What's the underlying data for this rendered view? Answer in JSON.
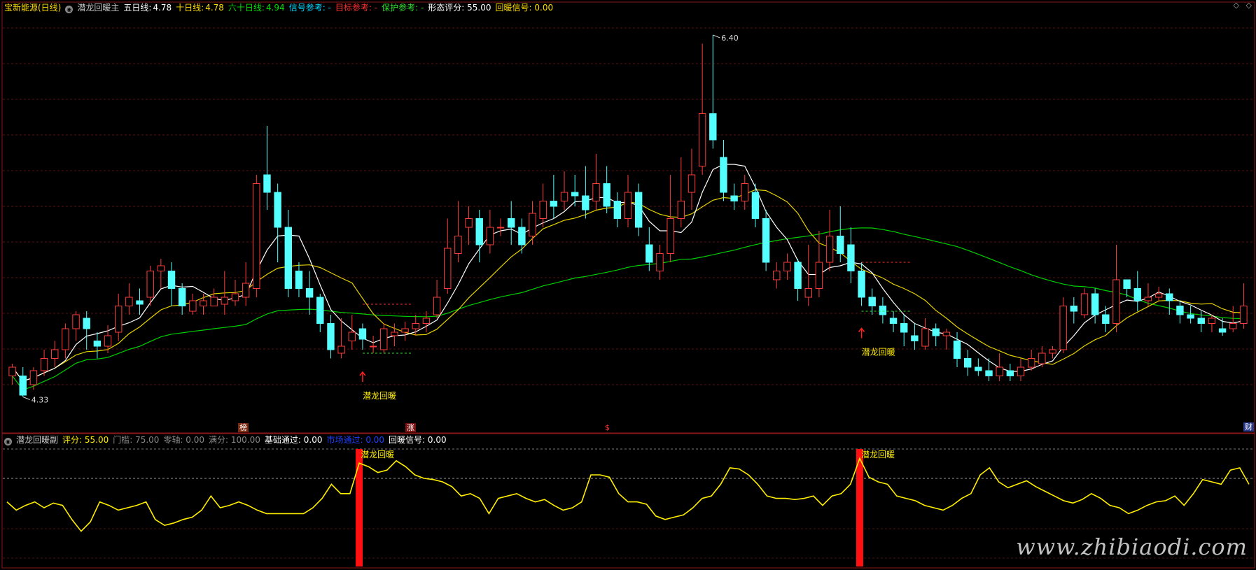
{
  "main_header": {
    "stock": "宝新能源(日线)",
    "indicator": "潜龙回暖主",
    "ma5_label": "五日线:",
    "ma5_value": "4.78",
    "ma10_label": "十日线:",
    "ma10_value": "4.78",
    "ma60_label": "六十日线:",
    "ma60_value": "4.94",
    "signal_ref": "信号参考: -",
    "target_ref": "目标参考: -",
    "protect_ref": "保护参考: -",
    "shape_score": "形态评分: 55.00",
    "warm_signal": "回暖信号: 0.00"
  },
  "sub_header": {
    "indicator": "潜龙回暖副",
    "score": "评分: 55.00",
    "threshold": "门槛: 75.00",
    "zero_axis": "零轴: 0.00",
    "full_score": "满分: 100.00",
    "base_pass": "基础通过: 0.00",
    "market_pass": "市场通过: 0.00",
    "warm_signal": "回暖信号: 0.00"
  },
  "markers": {
    "high_label": "6.40",
    "low_label": "4.33",
    "signal_text": "潜龙回暖",
    "bottom_tag_1": "榜",
    "bottom_tag_2": "涨",
    "bottom_tag_3": "$",
    "corner_tag": "财",
    "watermark": "www.zhibiaodi.com"
  },
  "colors": {
    "up": "#ff3c3c",
    "down": "#54ffff",
    "ma5": "#ffffff",
    "ma10": "#e6d200",
    "ma60": "#00d000",
    "score_line": "#ffee00",
    "signal_bar": "#ff1010"
  },
  "chart_data": [
    {
      "type": "candlestick",
      "title": "宝新能源(日线)",
      "ylim": [
        4.2,
        6.5
      ],
      "series": [
        {
          "name": "五日线"
        },
        {
          "name": "十日线"
        },
        {
          "name": "六十日线"
        }
      ],
      "candles": [
        [
          4.45,
          4.5,
          4.4,
          4.52
        ],
        [
          4.45,
          4.34,
          4.33,
          4.5
        ],
        [
          4.4,
          4.48,
          4.37,
          4.5
        ],
        [
          4.48,
          4.55,
          4.45,
          4.6
        ],
        [
          4.55,
          4.6,
          4.5,
          4.65
        ],
        [
          4.6,
          4.72,
          4.55,
          4.75
        ],
        [
          4.72,
          4.8,
          4.65,
          4.82
        ],
        [
          4.78,
          4.72,
          4.6,
          4.82
        ],
        [
          4.65,
          4.62,
          4.55,
          4.7
        ],
        [
          4.62,
          4.68,
          4.58,
          4.74
        ],
        [
          4.7,
          4.85,
          4.65,
          4.92
        ],
        [
          4.85,
          4.9,
          4.8,
          4.98
        ],
        [
          4.88,
          4.86,
          4.8,
          4.95
        ],
        [
          4.9,
          5.05,
          4.85,
          5.08
        ],
        [
          5.05,
          5.08,
          4.95,
          5.12
        ],
        [
          5.05,
          4.95,
          4.85,
          5.1
        ],
        [
          4.95,
          4.85,
          4.8,
          4.98
        ],
        [
          4.82,
          4.88,
          4.8,
          4.92
        ],
        [
          4.85,
          4.88,
          4.8,
          4.92
        ],
        [
          4.85,
          4.9,
          4.85,
          4.95
        ],
        [
          4.86,
          4.9,
          4.8,
          5.05
        ],
        [
          4.88,
          4.92,
          4.85,
          5.0
        ],
        [
          4.9,
          4.98,
          4.85,
          5.1
        ],
        [
          4.95,
          5.55,
          4.9,
          5.6
        ],
        [
          5.6,
          5.5,
          5.4,
          5.88
        ],
        [
          5.5,
          5.3,
          5.1,
          5.55
        ],
        [
          5.3,
          4.95,
          4.9,
          5.4
        ],
        [
          5.05,
          4.95,
          4.9,
          5.1
        ],
        [
          4.95,
          4.9,
          4.8,
          5.05
        ],
        [
          4.9,
          4.75,
          4.7,
          4.92
        ],
        [
          4.75,
          4.6,
          4.55,
          4.8
        ],
        [
          4.58,
          4.62,
          4.55,
          4.78
        ],
        [
          4.65,
          4.7,
          4.6,
          4.8
        ],
        [
          4.72,
          4.66,
          4.6,
          4.75
        ],
        [
          4.62,
          4.62,
          4.58,
          4.68
        ],
        [
          4.6,
          4.72,
          4.58,
          4.75
        ],
        [
          4.68,
          4.7,
          4.62,
          4.75
        ],
        [
          4.7,
          4.72,
          4.65,
          4.76
        ],
        [
          4.72,
          4.75,
          4.68,
          4.8
        ],
        [
          4.75,
          4.78,
          4.7,
          4.82
        ],
        [
          4.8,
          4.9,
          4.78,
          5.0
        ],
        [
          4.95,
          5.18,
          4.92,
          5.35
        ],
        [
          5.15,
          5.25,
          5.1,
          5.45
        ],
        [
          5.3,
          5.35,
          5.2,
          5.42
        ],
        [
          5.35,
          5.2,
          5.1,
          5.4
        ],
        [
          5.2,
          5.3,
          5.15,
          5.4
        ],
        [
          5.3,
          5.3,
          5.25,
          5.35
        ],
        [
          5.35,
          5.3,
          5.2,
          5.45
        ],
        [
          5.3,
          5.2,
          5.15,
          5.35
        ],
        [
          5.25,
          5.38,
          5.2,
          5.45
        ],
        [
          5.35,
          5.45,
          5.3,
          5.55
        ],
        [
          5.45,
          5.42,
          5.35,
          5.6
        ],
        [
          5.45,
          5.5,
          5.4,
          5.62
        ],
        [
          5.5,
          5.48,
          5.42,
          5.6
        ],
        [
          5.48,
          5.4,
          5.35,
          5.65
        ],
        [
          5.45,
          5.55,
          5.4,
          5.72
        ],
        [
          5.55,
          5.42,
          5.38,
          5.65
        ],
        [
          5.45,
          5.35,
          5.3,
          5.5
        ],
        [
          5.35,
          5.5,
          5.3,
          5.6
        ],
        [
          5.5,
          5.3,
          5.25,
          5.55
        ],
        [
          5.2,
          5.1,
          5.05,
          5.3
        ],
        [
          5.05,
          5.15,
          5.0,
          5.2
        ],
        [
          5.15,
          5.35,
          5.1,
          5.6
        ],
        [
          5.35,
          5.45,
          5.3,
          5.7
        ],
        [
          5.5,
          5.6,
          5.4,
          5.75
        ],
        [
          5.65,
          5.95,
          5.6,
          6.35
        ],
        [
          5.95,
          5.8,
          5.75,
          6.4
        ],
        [
          5.7,
          5.5,
          5.45,
          5.8
        ],
        [
          5.48,
          5.45,
          5.4,
          5.55
        ],
        [
          5.45,
          5.55,
          5.4,
          5.6
        ],
        [
          5.5,
          5.35,
          5.3,
          5.55
        ],
        [
          5.35,
          5.1,
          5.05,
          5.4
        ],
        [
          5.0,
          5.05,
          4.95,
          5.1
        ],
        [
          5.05,
          5.1,
          5.0,
          5.15
        ],
        [
          5.1,
          4.95,
          4.88,
          5.12
        ],
        [
          4.9,
          4.95,
          4.85,
          5.2
        ],
        [
          4.95,
          5.1,
          4.9,
          5.28
        ],
        [
          5.1,
          5.25,
          5.05,
          5.4
        ],
        [
          5.25,
          5.15,
          5.1,
          5.42
        ],
        [
          5.2,
          5.05,
          4.98,
          5.3
        ],
        [
          5.05,
          4.9,
          4.85,
          5.1
        ],
        [
          4.9,
          4.85,
          4.8,
          4.95
        ],
        [
          4.85,
          4.8,
          4.75,
          4.9
        ],
        [
          4.78,
          4.75,
          4.7,
          4.82
        ],
        [
          4.75,
          4.7,
          4.62,
          4.8
        ],
        [
          4.68,
          4.65,
          4.6,
          4.75
        ],
        [
          4.62,
          4.72,
          4.6,
          4.78
        ],
        [
          4.72,
          4.68,
          4.62,
          4.75
        ],
        [
          4.68,
          4.7,
          4.6,
          4.72
        ],
        [
          4.65,
          4.55,
          4.5,
          4.7
        ],
        [
          4.55,
          4.5,
          4.45,
          4.6
        ],
        [
          4.5,
          4.48,
          4.45,
          4.55
        ],
        [
          4.48,
          4.45,
          4.42,
          4.55
        ],
        [
          4.45,
          4.5,
          4.42,
          4.58
        ],
        [
          4.48,
          4.45,
          4.42,
          4.52
        ],
        [
          4.45,
          4.5,
          4.42,
          4.55
        ],
        [
          4.5,
          4.55,
          4.48,
          4.6
        ],
        [
          4.52,
          4.58,
          4.5,
          4.62
        ],
        [
          4.58,
          4.6,
          4.55,
          4.62
        ],
        [
          4.6,
          4.85,
          4.58,
          4.9
        ],
        [
          4.85,
          4.82,
          4.75,
          4.9
        ],
        [
          4.8,
          4.92,
          4.78,
          4.95
        ],
        [
          4.92,
          4.8,
          4.75,
          4.95
        ],
        [
          4.8,
          4.75,
          4.7,
          4.85
        ],
        [
          4.75,
          5.0,
          4.7,
          5.2
        ],
        [
          5.0,
          4.95,
          4.9,
          5.0
        ],
        [
          4.95,
          4.88,
          4.82,
          5.05
        ],
        [
          4.88,
          4.9,
          4.85,
          4.98
        ],
        [
          4.9,
          4.92,
          4.88,
          4.96
        ],
        [
          4.92,
          4.88,
          4.8,
          4.95
        ],
        [
          4.85,
          4.8,
          4.75,
          4.88
        ],
        [
          4.8,
          4.78,
          4.75,
          4.85
        ],
        [
          4.78,
          4.75,
          4.7,
          4.82
        ],
        [
          4.75,
          4.78,
          4.7,
          4.8
        ],
        [
          4.72,
          4.7,
          4.68,
          4.78
        ],
        [
          4.72,
          4.75,
          4.7,
          4.85
        ],
        [
          4.75,
          4.85,
          4.72,
          4.98
        ]
      ]
    },
    {
      "type": "line",
      "title": "潜龙回暖副",
      "ylim": [
        0,
        100
      ],
      "series": [
        {
          "name": "评分",
          "values": [
            55,
            48,
            52,
            55,
            50,
            54,
            52,
            40,
            30,
            38,
            55,
            52,
            48,
            50,
            52,
            55,
            40,
            35,
            37,
            40,
            42,
            48,
            60,
            50,
            52,
            55,
            52,
            48,
            45,
            45,
            45,
            45,
            45,
            50,
            58,
            70,
            62,
            62,
            88,
            85,
            80,
            82,
            90,
            85,
            78,
            75,
            74,
            72,
            68,
            60,
            62,
            58,
            45,
            58,
            60,
            62,
            58,
            55,
            57,
            52,
            48,
            50,
            55,
            78,
            78,
            76,
            62,
            55,
            55,
            53,
            43,
            40,
            42,
            44,
            50,
            58,
            60,
            70,
            84,
            83,
            78,
            70,
            60,
            58,
            58,
            57,
            58,
            60,
            52,
            60,
            62,
            70,
            92,
            76,
            72,
            70,
            60,
            58,
            56,
            52,
            50,
            48,
            52,
            58,
            62,
            78,
            84,
            72,
            67,
            70,
            73,
            68,
            64,
            60,
            56,
            54,
            57,
            62,
            58,
            52,
            50,
            45,
            48,
            52,
            55,
            56,
            60,
            52,
            62,
            74,
            72,
            70,
            82,
            84,
            70
          ]
        }
      ],
      "threshold": 75,
      "signal_indices": [
        38,
        92
      ]
    }
  ]
}
